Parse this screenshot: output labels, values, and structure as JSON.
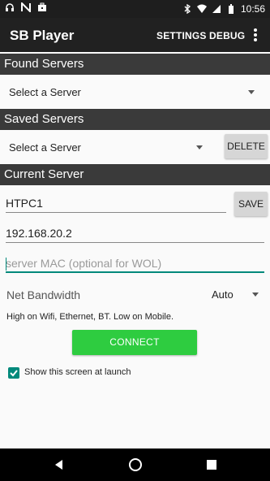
{
  "status_bar": {
    "time": "10:56",
    "left_icons": [
      "headset-icon",
      "notification-n-icon",
      "briefcase-icon"
    ],
    "right_icons": [
      "bluetooth-icon",
      "wifi-icon",
      "signal-icon",
      "battery-icon"
    ]
  },
  "app_bar": {
    "title": "SB Player",
    "settings_label": "SETTINGS",
    "debug_label": "DEBUG"
  },
  "found_servers": {
    "header": "Found Servers",
    "select_label": "Select a Server"
  },
  "saved_servers": {
    "header": "Saved Servers",
    "select_label": "Select a Server",
    "delete_label": "DELETE"
  },
  "current_server": {
    "header": "Current Server",
    "name_value": "HTPC1",
    "save_label": "SAVE",
    "ip_value": "192.168.20.2",
    "mac_placeholder": "server MAC (optional for WOL)",
    "bandwidth_label": "Net Bandwidth",
    "bandwidth_value": "Auto",
    "bandwidth_hint": "High on Wifi, Ethernet, BT. Low on Mobile.",
    "connect_label": "CONNECT",
    "show_at_launch_label": "Show this screen at launch",
    "show_at_launch_checked": true
  },
  "colors": {
    "accent": "#00897b",
    "connect": "#2ecc40",
    "app_bar": "#212121",
    "section_header": "#3a3a3a"
  }
}
